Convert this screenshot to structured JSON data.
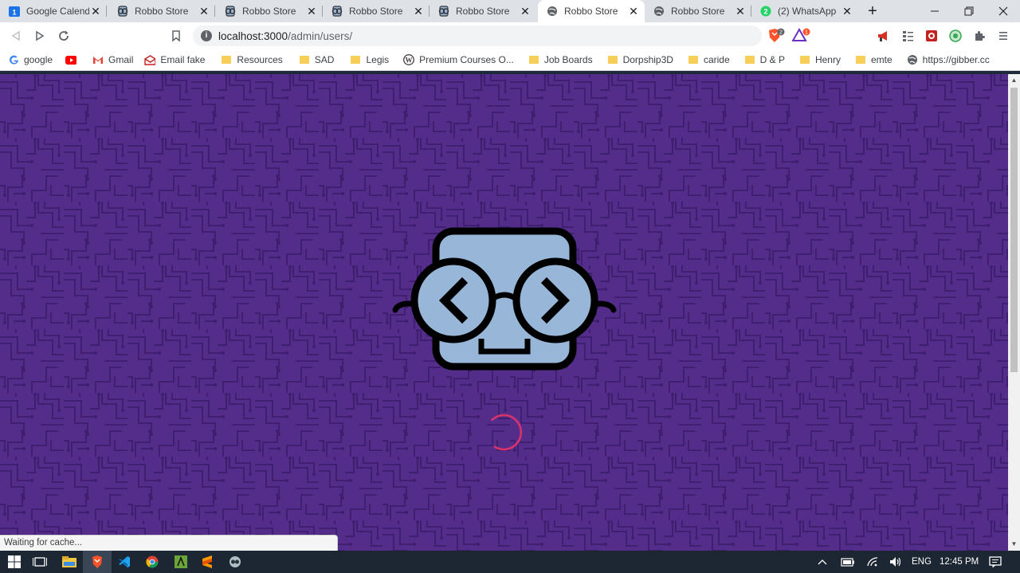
{
  "browser": {
    "tabs": [
      {
        "label": "Google Calendar",
        "favicon": "calendar-icon",
        "active": false
      },
      {
        "label": "Robbo Store",
        "favicon": "robbo-icon",
        "active": false
      },
      {
        "label": "Robbo Store",
        "favicon": "robbo-icon",
        "active": false
      },
      {
        "label": "Robbo Store",
        "favicon": "robbo-icon",
        "active": false
      },
      {
        "label": "Robbo Store",
        "favicon": "robbo-icon",
        "active": false
      },
      {
        "label": "Robbo Store",
        "favicon": "globe-icon",
        "active": true
      },
      {
        "label": "Robbo Store",
        "favicon": "globe-icon",
        "active": false
      },
      {
        "label": "(2) WhatsApp",
        "favicon": "whatsapp-icon",
        "active": false
      }
    ],
    "url_host": "localhost:3000",
    "url_path": "/admin/users/",
    "brave_shield_count": "2",
    "rewards_count": "1",
    "bookmarks": [
      {
        "label": "google",
        "icon": "google-icon"
      },
      {
        "label": "",
        "icon": "youtube-icon"
      },
      {
        "label": "Gmail",
        "icon": "gmail-icon"
      },
      {
        "label": "Email fake",
        "icon": "mail-icon"
      },
      {
        "label": "Resources",
        "icon": "folder-icon"
      },
      {
        "label": "SAD",
        "icon": "folder-icon"
      },
      {
        "label": "Legis",
        "icon": "folder-icon"
      },
      {
        "label": "Premium Courses O...",
        "icon": "wordpress-icon"
      },
      {
        "label": "Job Boards",
        "icon": "folder-icon"
      },
      {
        "label": "Dorpship3D",
        "icon": "folder-icon"
      },
      {
        "label": "caride",
        "icon": "folder-icon"
      },
      {
        "label": "D & P",
        "icon": "folder-icon"
      },
      {
        "label": "Henry",
        "icon": "folder-icon"
      },
      {
        "label": "emte",
        "icon": "folder-icon"
      },
      {
        "label": "https://gibber.cc",
        "icon": "globe-icon"
      }
    ],
    "status_text": "Waiting for cache..."
  },
  "page": {
    "background_color": "#542d8a",
    "robot_face_color": "#98b6d8",
    "spinner_color": "#d6336c"
  },
  "taskbar": {
    "language": "ENG",
    "time": "12:45 PM",
    "apps": [
      "windows-icon",
      "task-view-icon",
      "file-explorer-icon",
      "brave-icon",
      "vscode-icon",
      "chrome-icon",
      "git-icon",
      "sublime-icon",
      "robbo-app-icon"
    ]
  }
}
